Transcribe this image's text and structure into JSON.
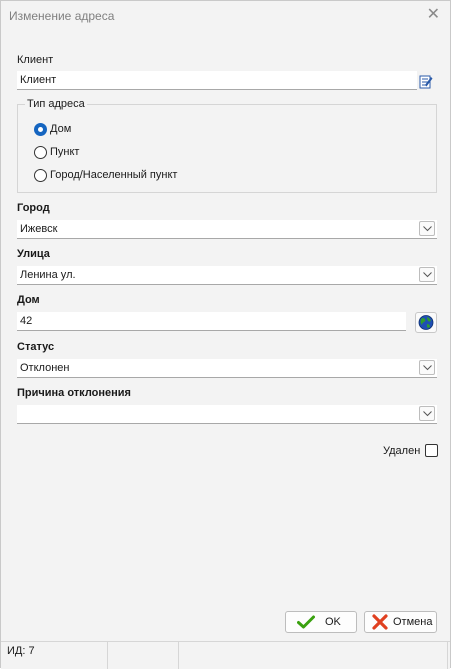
{
  "window": {
    "title": "Изменение адреса"
  },
  "client": {
    "label": "Клиент",
    "value": "Клиент"
  },
  "address_type": {
    "label": "Тип адреса",
    "options": [
      {
        "label": "Дом",
        "selected": true
      },
      {
        "label": "Пункт",
        "selected": false
      },
      {
        "label": "Город/Населенный пункт",
        "selected": false
      }
    ]
  },
  "city": {
    "label": "Город",
    "value": "Ижевск"
  },
  "street": {
    "label": "Улица",
    "value": "Ленина ул."
  },
  "house": {
    "label": "Дом",
    "value": "42"
  },
  "status": {
    "label": "Статус",
    "value": "Отклонен"
  },
  "reject_reason": {
    "label": "Причина отклонения",
    "value": ""
  },
  "deleted": {
    "label": "Удален",
    "checked": false
  },
  "buttons": {
    "ok": "OK",
    "cancel": "Отмена"
  },
  "statusbar": {
    "id_text": "ИД: 7"
  },
  "colors": {
    "radio_selected": "#1565c0",
    "ok_icon": "#3aa10f",
    "cancel_icon": "#e04020"
  }
}
